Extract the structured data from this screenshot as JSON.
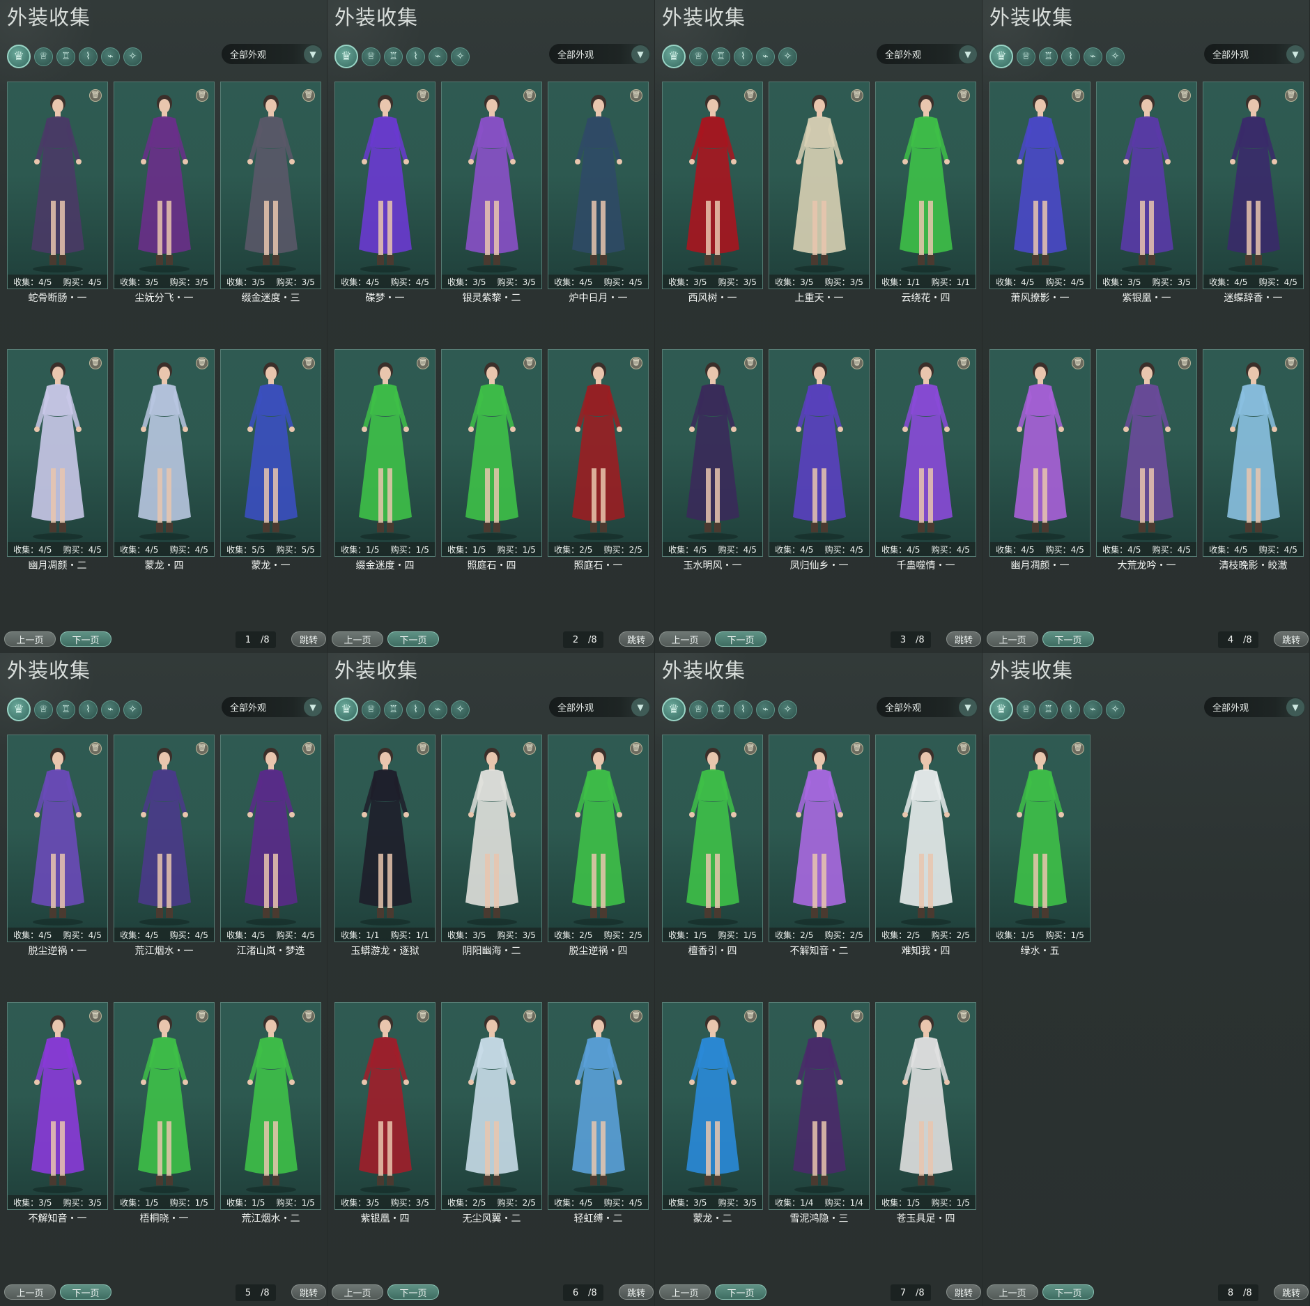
{
  "screen": {
    "panel_title": "外装收集",
    "filter_label": "全部外观",
    "prev_label": "上一页",
    "next_label": "下一页",
    "jump_label": "跳转",
    "total_pages": "/8",
    "collect_prefix": "收集：",
    "buy_prefix": "购买："
  },
  "filter_icons": [
    "all-outfit-icon",
    "hat-icon",
    "top-icon",
    "pants-icon",
    "shoes-icon",
    "accessory-icon"
  ],
  "pages": [
    {
      "page": "1",
      "cards": [
        {
          "name": "蛇骨断肠・一",
          "collect": "4/5",
          "buy": "4/5",
          "color": "#4a3a66"
        },
        {
          "name": "尘妩分飞・一",
          "collect": "3/5",
          "buy": "3/5",
          "color": "#6a2f8a"
        },
        {
          "name": "缀金迷度・三",
          "collect": "3/5",
          "buy": "3/5",
          "color": "#5a5868"
        },
        {
          "name": "幽月凋颜・二",
          "collect": "4/5",
          "buy": "4/5",
          "color": "#c9c8e8"
        },
        {
          "name": "蒙龙・四",
          "collect": "4/5",
          "buy": "4/5",
          "color": "#b8c6e0"
        },
        {
          "name": "蒙龙・一",
          "collect": "5/5",
          "buy": "5/5",
          "color": "#3b4fc0"
        }
      ]
    },
    {
      "page": "2",
      "cards": [
        {
          "name": "碟梦・一",
          "collect": "4/5",
          "buy": "4/5",
          "color": "#6a3ad0"
        },
        {
          "name": "银灵紫黎・二",
          "collect": "3/5",
          "buy": "3/5",
          "color": "#8a50c8"
        },
        {
          "name": "炉中日月・一",
          "collect": "4/5",
          "buy": "4/5",
          "color": "#2f4a66"
        },
        {
          "name": "缀金迷度・四",
          "collect": "1/5",
          "buy": "1/5",
          "color": "#3ec048"
        },
        {
          "name": "照庭石・四",
          "collect": "1/5",
          "buy": "1/5",
          "color": "#3ec048"
        },
        {
          "name": "照庭石・一",
          "collect": "2/5",
          "buy": "2/5",
          "color": "#9a1e22"
        }
      ]
    },
    {
      "page": "3",
      "cards": [
        {
          "name": "西风树・一",
          "collect": "3/5",
          "buy": "3/5",
          "color": "#a8151f"
        },
        {
          "name": "上重天・一",
          "collect": "3/5",
          "buy": "3/5",
          "color": "#d8d0b4"
        },
        {
          "name": "云绕花・四",
          "collect": "1/1",
          "buy": "1/1",
          "color": "#3ec048"
        },
        {
          "name": "玉水明风・一",
          "collect": "4/5",
          "buy": "4/5",
          "color": "#3a2a5a"
        },
        {
          "name": "凤归仙乡・一",
          "collect": "4/5",
          "buy": "4/5",
          "color": "#5a40c0"
        },
        {
          "name": "千蛊噬情・一",
          "collect": "4/5",
          "buy": "4/5",
          "color": "#8a4ad8"
        }
      ]
    },
    {
      "page": "4",
      "cards": [
        {
          "name": "萧风撩影・一",
          "collect": "4/5",
          "buy": "4/5",
          "color": "#4a48c8"
        },
        {
          "name": "紫银凰・一",
          "collect": "3/5",
          "buy": "3/5",
          "color": "#5a3aa8"
        },
        {
          "name": "迷蝶辞香・一",
          "collect": "4/5",
          "buy": "4/5",
          "color": "#3a2a6a"
        },
        {
          "name": "幽月凋颜・一",
          "collect": "4/5",
          "buy": "4/5",
          "color": "#a860d8"
        },
        {
          "name": "大荒龙吟・一",
          "collect": "4/5",
          "buy": "4/5",
          "color": "#6a4a9a"
        },
        {
          "name": "清枝晚影・皎澈",
          "collect": "4/5",
          "buy": "4/5",
          "color": "#8ac0e0"
        }
      ]
    },
    {
      "page": "5",
      "cards": [
        {
          "name": "脱尘逆祸・一",
          "collect": "4/5",
          "buy": "4/5",
          "color": "#6a4ab8"
        },
        {
          "name": "荒江烟水・一",
          "collect": "4/5",
          "buy": "4/5",
          "color": "#4a3a8a"
        },
        {
          "name": "江渚山岚・梦迭",
          "collect": "4/5",
          "buy": "4/5",
          "color": "#5a2a8a"
        },
        {
          "name": "不解知音・一",
          "collect": "3/5",
          "buy": "3/5",
          "color": "#8a3ad8"
        },
        {
          "name": "梧桐晓・一",
          "collect": "1/5",
          "buy": "1/5",
          "color": "#3ec048"
        },
        {
          "name": "荒江烟水・二",
          "collect": "1/5",
          "buy": "1/5",
          "color": "#3ec048"
        }
      ]
    },
    {
      "page": "6",
      "cards": [
        {
          "name": "玉蟒游龙・逐狱",
          "collect": "1/1",
          "buy": "1/1",
          "color": "#1e1e2a"
        },
        {
          "name": "阴阳幽海・二",
          "collect": "3/5",
          "buy": "3/5",
          "color": "#e0e0dc"
        },
        {
          "name": "脱尘逆祸・四",
          "collect": "2/5",
          "buy": "2/5",
          "color": "#3ec048"
        },
        {
          "name": "紫银凰・四",
          "collect": "3/5",
          "buy": "3/5",
          "color": "#a01e2a"
        },
        {
          "name": "无尘风翼・二",
          "collect": "2/5",
          "buy": "2/5",
          "color": "#c8dce8"
        },
        {
          "name": "轻虹缚・二",
          "collect": "4/5",
          "buy": "4/5",
          "color": "#5aa0d8"
        }
      ]
    },
    {
      "page": "7",
      "cards": [
        {
          "name": "檀香引・四",
          "collect": "1/5",
          "buy": "1/5",
          "color": "#3ec048"
        },
        {
          "name": "不解知音・二",
          "collect": "2/5",
          "buy": "2/5",
          "color": "#a868e0"
        },
        {
          "name": "难知我・四",
          "collect": "2/5",
          "buy": "2/5",
          "color": "#e8ecec"
        },
        {
          "name": "蒙龙・二",
          "collect": "3/5",
          "buy": "3/5",
          "color": "#2a8ad8"
        },
        {
          "name": "雪泥鸿隐・三",
          "collect": "1/4",
          "buy": "1/4",
          "color": "#4a2a6a"
        },
        {
          "name": "苍玉具足・四",
          "collect": "1/5",
          "buy": "1/5",
          "color": "#e0e0e0"
        }
      ]
    },
    {
      "page": "8",
      "cards": [
        {
          "name": "绿水・五",
          "collect": "1/5",
          "buy": "1/5",
          "color": "#3ec048"
        }
      ]
    }
  ]
}
